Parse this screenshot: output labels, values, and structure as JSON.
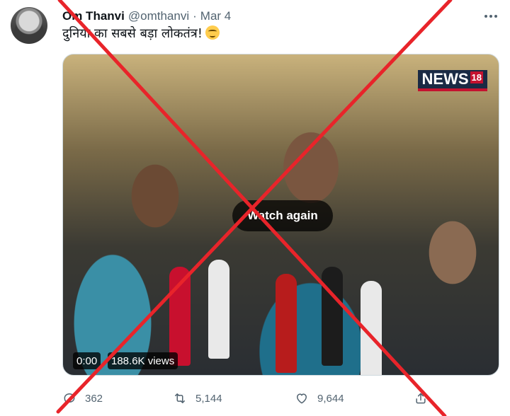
{
  "tweet": {
    "author_name": "Om Thanvi",
    "author_handle": "@omthanvi",
    "separator": "·",
    "date": "Mar 4",
    "text": "दुनिया का सबसे बड़ा लोकतंत्र!",
    "emoji_icon": "smirk-face-icon",
    "more_icon": "more-options-icon"
  },
  "media": {
    "logo_text": "NEWS",
    "logo_sup": "18",
    "watch_again_label": "Watch again",
    "elapsed": "0:00",
    "views": "188.6K views"
  },
  "actions": {
    "reply_count": "362",
    "retweet_count": "5,144",
    "like_count": "9,644",
    "reply_icon": "reply-icon",
    "retweet_icon": "retweet-icon",
    "like_icon": "heart-icon",
    "share_icon": "share-icon"
  },
  "overlay": {
    "cross_color": "#e8242a"
  },
  "colors": {
    "secondary_text": "#536471",
    "primary_text": "#0f1419"
  }
}
